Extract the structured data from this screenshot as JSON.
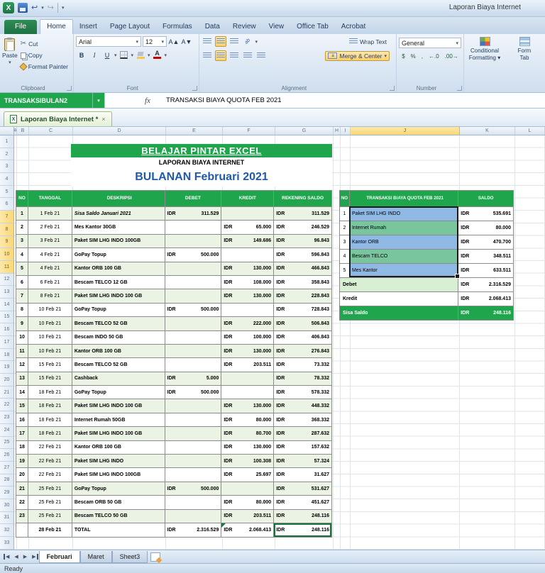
{
  "window": {
    "title": "Laporan Biaya Internet",
    "status": "Ready"
  },
  "icons": {
    "dropdown": "▾",
    "close": "×",
    "nav_prev": "◀",
    "nav_next": "▶",
    "undo": "↩",
    "redo": "↪",
    "scissors": "✂",
    "grow": "A▲",
    "shrink": "A▼",
    "bold": "B",
    "italic": "I",
    "underline": "U",
    "orient": "ab",
    "dollar": "$",
    "percent": "%",
    "comma": ",",
    "dec_inc": "←.0",
    "dec_dec": ".00→",
    "fx": "fx",
    "logo": "X"
  },
  "formula_bar": {
    "name_box": "TRANSAKSIBULAN2",
    "formula": "TRANSAKSI BIAYA QUOTA FEB 2021"
  },
  "office_tab": {
    "label": "Laporan Biaya Internet *"
  },
  "ribbon": {
    "file_tab": "File",
    "tabs": [
      "Home",
      "Insert",
      "Page Layout",
      "Formulas",
      "Data",
      "Review",
      "View",
      "Office Tab",
      "Acrobat"
    ],
    "active_tab": "Home",
    "clipboard": {
      "label": "Clipboard",
      "paste": "Paste",
      "cut": "Cut",
      "copy": "Copy",
      "format_painter": "Format Painter"
    },
    "font": {
      "label": "Font",
      "family": "Arial",
      "size": "12"
    },
    "alignment": {
      "label": "Alignment",
      "wrap_text": "Wrap Text",
      "merge_center": "Merge & Center"
    },
    "number": {
      "label": "Number",
      "format": "General"
    },
    "styles": {
      "conditional_line1": "Conditional",
      "conditional_line2": "Formatting ▾",
      "format_partial": "Form",
      "table_partial": "Tab"
    }
  },
  "grid": {
    "column_letters": [
      "A",
      "B",
      "C",
      "D",
      "E",
      "F",
      "G",
      "H",
      "I",
      "J",
      "K",
      "L"
    ],
    "selected_column": "J",
    "row_count": 33,
    "selected_rows": [
      7,
      8,
      9,
      10,
      11
    ]
  },
  "sheet": {
    "currency": "IDR",
    "banner": "BELAJAR PINTAR EXCEL",
    "subtitle": "LAPORAN BIAYA INTERNET",
    "month_title": "BULANAN Februari 2021",
    "expense_table": {
      "headers": [
        "NO",
        "TANGGAL",
        "DESKRIPSI",
        "DEBET",
        "KREDIT",
        "REKENING SALDO"
      ],
      "rows": [
        {
          "no": "1",
          "tanggal": "1 Feb 21",
          "deskripsi": "Sisa Saldo Januari 2021",
          "debet": "311.529",
          "kredit": "",
          "saldo": "311.529",
          "italic": true
        },
        {
          "no": "2",
          "tanggal": "2 Feb 21",
          "deskripsi": "Mes Kantor 30GB",
          "debet": "",
          "kredit": "65.000",
          "saldo": "246.529"
        },
        {
          "no": "3",
          "tanggal": "3 Feb 21",
          "deskripsi": "Paket SIM LHG INDO 100GB",
          "debet": "",
          "kredit": "149.686",
          "saldo": "96.843"
        },
        {
          "no": "4",
          "tanggal": "4 Feb 21",
          "deskripsi": "GoPay Topup",
          "debet": "500.000",
          "kredit": "",
          "saldo": "596.843"
        },
        {
          "no": "5",
          "tanggal": "4 Feb 21",
          "deskripsi": "Kantor ORB 100 GB",
          "debet": "",
          "kredit": "130.000",
          "saldo": "466.843"
        },
        {
          "no": "6",
          "tanggal": "6 Feb 21",
          "deskripsi": "Bescam TELCO 12 GB",
          "debet": "",
          "kredit": "108.000",
          "saldo": "358.843"
        },
        {
          "no": "7",
          "tanggal": "8 Feb 21",
          "deskripsi": "Paket SIM LHG INDO 100 GB",
          "debet": "",
          "kredit": "130.000",
          "saldo": "228.843"
        },
        {
          "no": "8",
          "tanggal": "10 Feb 21",
          "deskripsi": "GoPay Topup",
          "debet": "500.000",
          "kredit": "",
          "saldo": "728.843"
        },
        {
          "no": "9",
          "tanggal": "10 Feb 21",
          "deskripsi": "Bescam TELCO 52 GB",
          "debet": "",
          "kredit": "222.000",
          "saldo": "506.843"
        },
        {
          "no": "10",
          "tanggal": "10 Feb 21",
          "deskripsi": "Bescam INDO 50 GB",
          "debet": "",
          "kredit": "100.000",
          "saldo": "406.843"
        },
        {
          "no": "11",
          "tanggal": "10 Feb 21",
          "deskripsi": "Kantor ORB 100 GB",
          "debet": "",
          "kredit": "130.000",
          "saldo": "276.843"
        },
        {
          "no": "12",
          "tanggal": "15 Feb 21",
          "deskripsi": "Bescam TELCO 52 GB",
          "debet": "",
          "kredit": "203.511",
          "saldo": "73.332"
        },
        {
          "no": "13",
          "tanggal": "15 Feb 21",
          "deskripsi": "Cashback",
          "debet": "5.000",
          "kredit": "",
          "saldo": "78.332"
        },
        {
          "no": "14",
          "tanggal": "18 Feb 21",
          "deskripsi": "GoPay Topup",
          "debet": "500.000",
          "kredit": "",
          "saldo": "578.332"
        },
        {
          "no": "15",
          "tanggal": "18 Feb 21",
          "deskripsi": "Paket SIM LHG INDO 100 GB",
          "debet": "",
          "kredit": "130.000",
          "saldo": "448.332"
        },
        {
          "no": "16",
          "tanggal": "18 Feb 21",
          "deskripsi": "Internet Rumah 50GB",
          "debet": "",
          "kredit": "80.000",
          "saldo": "368.332"
        },
        {
          "no": "17",
          "tanggal": "18 Feb 21",
          "deskripsi": "Paket SIM LHG INDO 100 GB",
          "debet": "",
          "kredit": "80.700",
          "saldo": "287.632"
        },
        {
          "no": "18",
          "tanggal": "22 Feb 21",
          "deskripsi": "Kantor ORB 100 GB",
          "debet": "",
          "kredit": "130.000",
          "saldo": "157.632"
        },
        {
          "no": "19",
          "tanggal": "22 Feb 21",
          "deskripsi": "Paket SIM LHG INDO",
          "debet": "",
          "kredit": "100.308",
          "saldo": "57.324"
        },
        {
          "no": "20",
          "tanggal": "22 Feb 21",
          "deskripsi": "Paket SIM LHG INDO 100GB",
          "debet": "",
          "kredit": "25.697",
          "saldo": "31.627"
        },
        {
          "no": "21",
          "tanggal": "25 Feb 21",
          "deskripsi": "GoPay Topup",
          "debet": "500.000",
          "kredit": "",
          "saldo": "531.627"
        },
        {
          "no": "22",
          "tanggal": "25 Feb 21",
          "deskripsi": "Bescam ORB 50 GB",
          "debet": "",
          "kredit": "80.000",
          "saldo": "451.627"
        },
        {
          "no": "23",
          "tanggal": "25 Feb 21",
          "deskripsi": "Bescam TELCO 50 GB",
          "debet": "",
          "kredit": "203.511",
          "saldo": "248.116"
        }
      ],
      "total": {
        "tanggal": "28 Feb 21",
        "label": "TOTAL",
        "debet": "2.316.529",
        "kredit": "2.068.413",
        "saldo": "248.116"
      }
    },
    "summary_table": {
      "headers": [
        "NO",
        "TRANSAKSI BIAYA QUOTA FEB 2021",
        "SALDO"
      ],
      "rows": [
        {
          "no": "1",
          "label": "Paket SIM LHG INDO",
          "saldo": "535.691",
          "fill": "blue"
        },
        {
          "no": "2",
          "label": "Internet Rumah",
          "saldo": "80.000",
          "fill": "green"
        },
        {
          "no": "3",
          "label": "Kantor ORB",
          "saldo": "470.700",
          "fill": "blue"
        },
        {
          "no": "4",
          "label": "Bescam TELCO",
          "saldo": "348.511",
          "fill": "green"
        },
        {
          "no": "5",
          "label": "Mes Kantor",
          "saldo": "633.511",
          "fill": "blue"
        }
      ],
      "debet_label": "Debet",
      "debet": "2.316.529",
      "kredit_label": "Kredit",
      "kredit": "2.068.413",
      "sisa_label": "Sisa Saldo",
      "sisa": "248.116"
    }
  },
  "sheet_tabs": {
    "tabs": [
      "Februari",
      "Maret",
      "Sheet3"
    ],
    "active": "Februari"
  }
}
